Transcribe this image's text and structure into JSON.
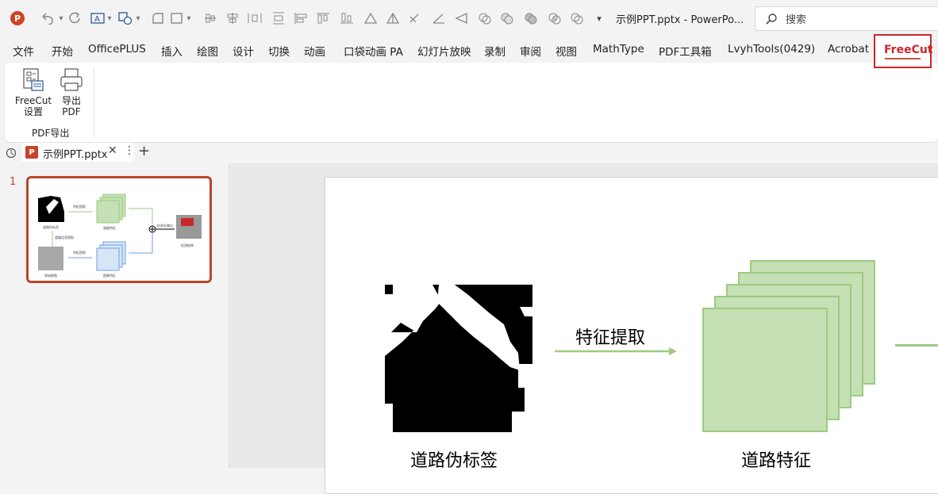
{
  "titlebar": {
    "app_logo": "P",
    "doc_title": "示例PPT.pptx  -  PowerPo...",
    "search_placeholder": "搜索",
    "quick_access_icons": [
      "undo-icon",
      "redo-icon",
      "text-box-icon",
      "shapes-icon",
      "rounded-rect-icon",
      "rectangle-icon",
      "align-icons",
      "triangle-icon",
      "format-icons",
      "dropdown-arrow-icon"
    ]
  },
  "tabs": [
    "文件",
    "开始",
    "OfficePLUS",
    "插入",
    "绘图",
    "设计",
    "切换",
    "动画",
    "口袋动画 PA",
    "幻灯片放映",
    "录制",
    "审阅",
    "视图",
    "MathType",
    "PDF工具箱",
    "LvyhTools(0429)",
    "Acrobat",
    "FreeCut"
  ],
  "active_tab": "FreeCut",
  "ribbon": {
    "buttons": [
      {
        "line1": "FreeCut",
        "line2": "设置"
      },
      {
        "line1": "导出",
        "line2": "PDF"
      }
    ],
    "group_label": "PDF导出"
  },
  "doc_tab": {
    "name": "示例PPT.pptx",
    "close": "✕",
    "more": "⋮",
    "add": "+"
  },
  "thumbnails": {
    "slide_number": "1"
  },
  "slide": {
    "label_pseudo": "道路伪标签",
    "arrow_text": "特征提取",
    "label_feature": "道路特征",
    "colors": {
      "green_fill": "#c5e0b4",
      "green_stroke": "#9ccb80",
      "accent": "#c8282d"
    }
  }
}
